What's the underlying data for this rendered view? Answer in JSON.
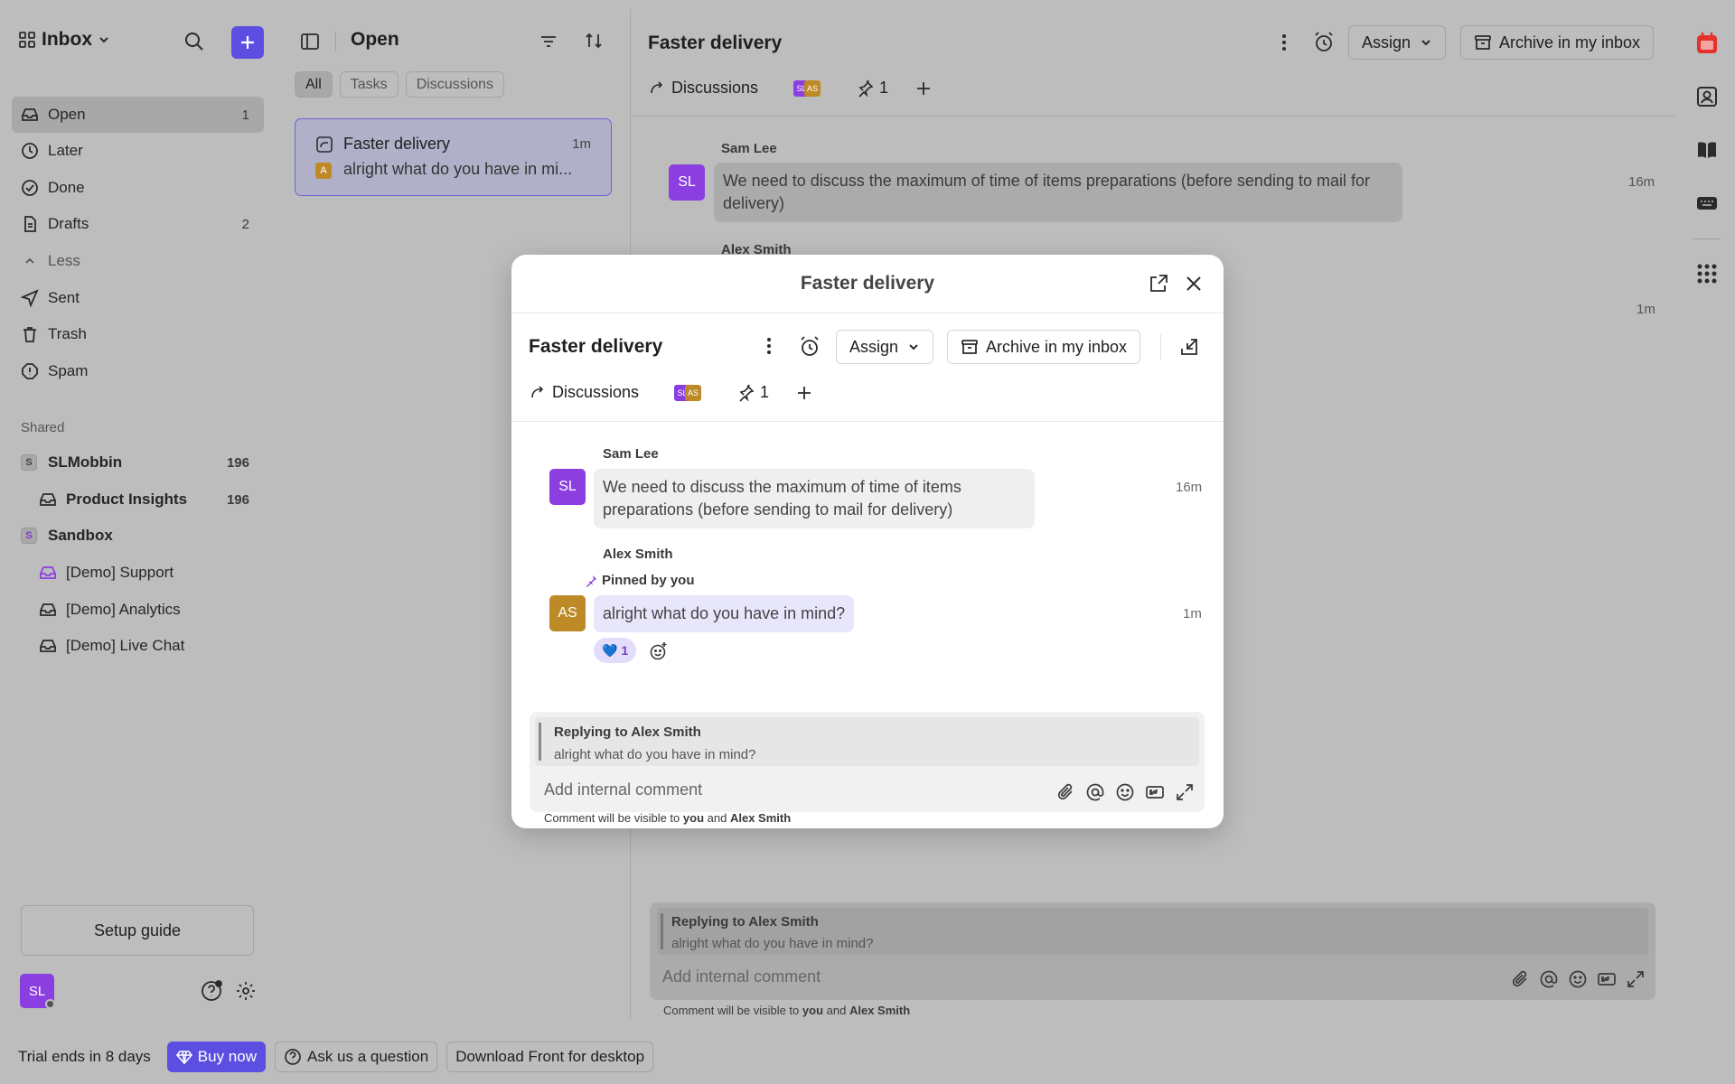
{
  "sidebar": {
    "inbox_label": "Inbox",
    "items": [
      {
        "label": "Open",
        "count": "1"
      },
      {
        "label": "Later",
        "count": ""
      },
      {
        "label": "Done",
        "count": ""
      },
      {
        "label": "Drafts",
        "count": "2"
      },
      {
        "label": "Less",
        "count": ""
      },
      {
        "label": "Sent",
        "count": ""
      },
      {
        "label": "Trash",
        "count": ""
      },
      {
        "label": "Spam",
        "count": ""
      }
    ],
    "shared_label": "Shared",
    "workspaces": [
      {
        "badge": "S",
        "label": "SLMobbin",
        "count": "196"
      },
      {
        "label": "Product Insights",
        "count": "196"
      },
      {
        "badge": "S",
        "label": "Sandbox"
      },
      {
        "label": "[Demo] Support"
      },
      {
        "label": "[Demo] Analytics"
      },
      {
        "label": "[Demo] Live Chat"
      }
    ],
    "setup_guide": "Setup guide",
    "user_initials": "SL"
  },
  "list": {
    "title": "Open",
    "filters": [
      "All",
      "Tasks",
      "Discussions"
    ],
    "conversation": {
      "title": "Faster delivery",
      "time": "1m",
      "avatar": "A",
      "preview": "alright what do you have in mi..."
    }
  },
  "main": {
    "title": "Faster delivery",
    "assign": "Assign",
    "archive": "Archive in my inbox",
    "discussions": "Discussions",
    "pin_count": "1",
    "messages": [
      {
        "author": "Sam Lee",
        "initials": "SL",
        "text": "We need to discuss the maximum of time of items preparations (before sending to mail for delivery)",
        "time": "16m"
      },
      {
        "author": "Alex Smith",
        "time": "1m"
      }
    ],
    "reply": {
      "replying_to": "Replying to Alex Smith",
      "quote": "alright what do you have in mind?",
      "placeholder": "Add internal comment",
      "visibility_prefix": "Comment will be visible to",
      "you": "you",
      "and": "and",
      "who": "Alex Smith"
    }
  },
  "modal": {
    "header": "Faster delivery",
    "title": "Faster delivery",
    "assign": "Assign",
    "archive": "Archive in my inbox",
    "discussions": "Discussions",
    "pin_count": "1",
    "msg1": {
      "author": "Sam Lee",
      "initials": "SL",
      "text": "We need to discuss the maximum of time of items preparations (before sending to mail for delivery)",
      "time": "16m"
    },
    "msg2": {
      "author": "Alex Smith",
      "initials": "AS",
      "pinned": "Pinned by you",
      "text": "alright what do you have in mind?",
      "time": "1m",
      "reaction": "💙",
      "reaction_count": "1"
    },
    "reply": {
      "replying_to": "Replying to Alex Smith",
      "quote": "alright what do you have in mind?",
      "placeholder": "Add internal comment",
      "visibility_prefix": "Comment will be visible to",
      "you": "you",
      "and": "and",
      "who": "Alex Smith"
    }
  },
  "bottom": {
    "trial": "Trial ends in 8 days",
    "buy": "Buy now",
    "ask": "Ask us a question",
    "download": "Download Front for desktop"
  },
  "colors": {
    "accent": "#5b4ee0",
    "purple": "#8b3fe0",
    "gold": "#bd8a27",
    "calendar_red": "#e5322d"
  }
}
